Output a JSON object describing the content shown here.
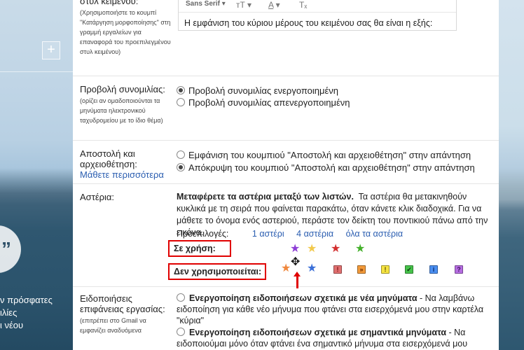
{
  "background": {
    "plus_label": "+",
    "hangouts_glyph": "”",
    "side_texts": [
      "ν πρόσφατες",
      "ιλίες",
      "ι νέου"
    ]
  },
  "text_style": {
    "title": "στυλ κειμένου:",
    "desc": "(Χρησιμοποιήστε το κουμπί \"Κατάργηση μορφοποίησης\" στη γραμμή εργαλείων για επαναφορά του προεπιλεγμένου στυλ κειμένου)",
    "font_select": "Sans Serif",
    "size_icon": "тT",
    "color_icon": "A",
    "clear_icon": "Tₓ",
    "preview_text": "Η εμφάνιση του κύριου μέρους του κειμένου σας θα είναι η εξής:"
  },
  "conversation_view": {
    "title": "Προβολή συνομιλίας:",
    "desc": "(ορίζει αν ομαδοποιούνται τα μηνύματα ηλεκτρονικού ταχυδρομείου με το ίδιο θέμα)",
    "options": [
      {
        "label": "Προβολή συνομιλίας ενεργοποιημένη",
        "selected": true
      },
      {
        "label": "Προβολή συνομιλίας απενεργοποιημένη",
        "selected": false
      }
    ]
  },
  "send_archive": {
    "title": "Αποστολή και αρχειοθέτηση:",
    "learn_more": "Μάθετε περισσότερα",
    "options": [
      {
        "label": "Εμφάνιση του κουμπιού \"Αποστολή και αρχειοθέτηση\" στην απάντηση",
        "selected": false
      },
      {
        "label": "Απόκρυψη του κουμπιού \"Αποστολή και αρχειοθέτηση\" στην απάντηση",
        "selected": true
      }
    ]
  },
  "stars": {
    "title": "Αστέρια:",
    "desc_bold": "Μεταφέρετε τα αστέρια μεταξύ των λιστών.",
    "desc_rest": "Τα αστέρια θα μετακινηθούν κυκλικά με τη σειρά που φαίνεται παρακάτω, όταν κάνετε κλικ διαδοχικά. Για να μάθετε το όνομα ενός αστεριού, περάστε τον δείκτη του ποντικιού πάνω από την εικόνα.",
    "presets_label": "Προεπιλογές:",
    "presets": [
      "1 αστέρι",
      "4 αστέρια",
      "όλα τα αστέρια"
    ],
    "in_use_label": "Σε χρήση:",
    "not_in_use_label": "Δεν χρησιμοποιείται:",
    "in_use": [
      {
        "name": "purple-star",
        "glyph": "★",
        "color": "#8e3fd6"
      },
      {
        "name": "yellow-star",
        "glyph": "★",
        "color": "#f2c94c"
      },
      {
        "name": "red-star",
        "glyph": "★",
        "color": "#d32f2f"
      },
      {
        "name": "green-star",
        "glyph": "★",
        "color": "#43b02a"
      }
    ],
    "not_in_use": [
      {
        "name": "orange-star",
        "glyph": "★",
        "color": "#f0883e"
      },
      {
        "name": "blue-star",
        "glyph": "★",
        "color": "#3b6fd8"
      },
      {
        "name": "red-bang",
        "glyph": "!",
        "color": "#e07070",
        "fg": "#7a1010"
      },
      {
        "name": "orange-guillemet",
        "glyph": "»",
        "color": "#f29a3a",
        "fg": "#6a2a00"
      },
      {
        "name": "yellow-bang",
        "glyph": "!",
        "color": "#f5e342",
        "fg": "#5a4a00"
      },
      {
        "name": "green-check",
        "glyph": "✔",
        "color": "#46c24a",
        "fg": "#0b3d0b"
      },
      {
        "name": "blue-info",
        "glyph": "i",
        "color": "#4a8ef0",
        "fg": "#0a2a6a"
      },
      {
        "name": "purple-question",
        "glyph": "?",
        "color": "#b56de0",
        "fg": "#3a0a5a"
      }
    ]
  },
  "desktop_notifications": {
    "title": "Ειδοποιήσεις επιφάνειας εργασίας:",
    "desc": "(επιτρέπει στο Gmail να εμφανίζει αναδυόμενα",
    "options": [
      {
        "bold": "Ενεργοποίηση ειδοποιήσεων σχετικά με νέα μηνύματα",
        "rest": " - Να λαμβάνω ειδοποίηση για κάθε νέο μήνυμα που φτάνει στα εισερχόμενά μου στην καρτέλα \"κύρια\"",
        "selected": false
      },
      {
        "bold": "Ενεργοποίηση ειδοποιήσεων σχετικά με σημαντικά μηνύματα",
        "rest": " - Να ειδοποιούμαι μόνο όταν φτάνει ένα σημαντικό μήνυμα στα εισερχόμενά μου",
        "selected": false
      }
    ]
  }
}
